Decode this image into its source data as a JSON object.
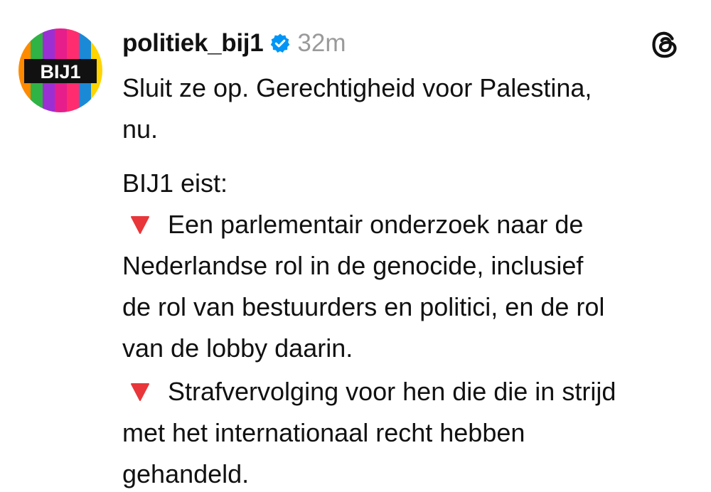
{
  "post": {
    "username": "politiek_bij1",
    "time": "32m",
    "avatar_text": "BIJ1",
    "intro_line1": "Sluit ze op. Gerechtigheid voor Palestina,",
    "intro_line2": "nu.",
    "demands_heading": "BIJ1 eist:",
    "demands": [
      {
        "line1": "Een parlementair onderzoek naar de",
        "line2": "Nederlandse rol in de genocide, inclusief",
        "line3": "de rol van bestuurders en politici, en de rol",
        "line4": "van de lobby daarin."
      },
      {
        "line1": "Strafvervolging voor hen die die in strijd",
        "line2": "met het internationaal recht hebben",
        "line3": "gehandeld."
      }
    ]
  },
  "icons": {
    "verified": "verified-badge-icon",
    "threads": "threads-logo-icon",
    "bullet": "red-down-triangle-icon"
  },
  "colors": {
    "verified_blue": "#0095f6",
    "time_gray": "#9a9a9a",
    "bullet_red": "#e8363a",
    "avatar_stripes": [
      "#ff8a00",
      "#2fb344",
      "#9b2fd4",
      "#e61e8c",
      "#ff2d6f",
      "#1a8ad6",
      "#ffd400"
    ]
  }
}
